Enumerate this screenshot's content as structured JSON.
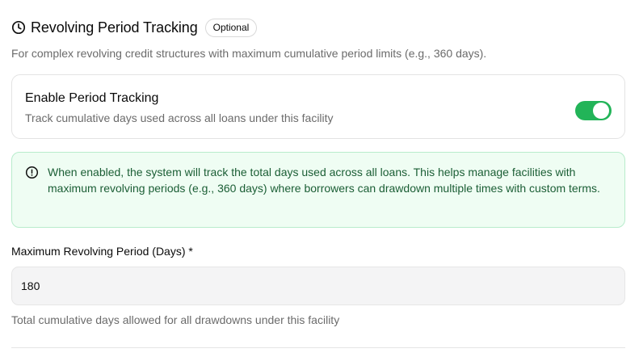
{
  "section": {
    "title": "Revolving Period Tracking",
    "badge": "Optional",
    "subtitle": "For complex revolving credit structures with maximum cumulative period limits (e.g., 360 days)."
  },
  "toggle": {
    "title": "Enable Period Tracking",
    "description": "Track cumulative days used across all loans under this facility",
    "enabled": true
  },
  "info": {
    "text": "When enabled, the system will track the total days used across all loans. This helps manage facilities with maximum revolving periods (e.g., 360 days) where borrowers can drawdown multiple times with custom terms."
  },
  "field": {
    "label": "Maximum Revolving Period (Days) *",
    "value": "180",
    "help": "Total cumulative days allowed for all drawdowns under this facility"
  },
  "icons": {
    "header": "clock-icon",
    "info": "info-circle-icon"
  },
  "colors": {
    "toggle_on": "#22b458",
    "info_background": "#effdf3",
    "info_border": "#b8eccc",
    "info_text": "#1b5e35"
  }
}
